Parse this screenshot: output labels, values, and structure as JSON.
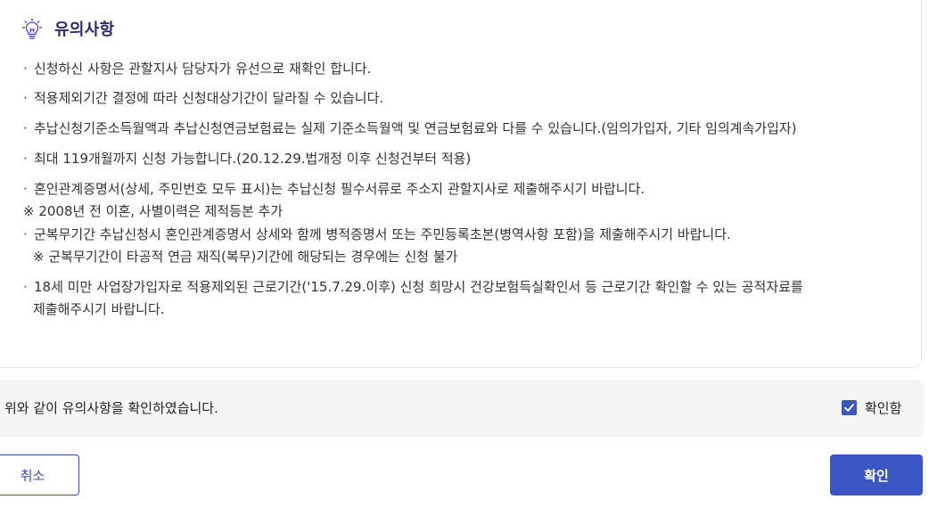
{
  "notice": {
    "title": "유의사항",
    "icon": "lightbulb-icon",
    "items": [
      "신청하신 사항은 관할지사 담당자가 유선으로 재확인 합니다.",
      "적용제외기간 결정에 따라 신청대상기간이 달라질 수 있습니다.",
      "추납신청기준소득월액과 추납신청연금보험료는 실제 기준소득월액 및 연금보험료와 다를 수 있습니다.(임의가입자, 기타 임의계속가입자)",
      "최대 119개월까지 신청 가능합니다.(20.12.29.법개정 이후 신청건부터 적용)",
      "혼인관계증명서(상세, 주민번호 모두 표시)는 추납신청 필수서류로 주소지 관할지사로 제출해주시기 바랍니다.",
      "군복무기간 추납신청시 혼인관계증명서 상세와 함께 병적증명서 또는 주민등록초본(병역사항 포함)을 제출해주시기 바랍니다.",
      "18세 미만 사업장가입자로 적용제외된 근로기간('15.7.29.이후) 신청 희망시 건강보험득실확인서 등 근로기간 확인할 수 있는 공적자료를",
      "제출해주시기 바랍니다."
    ],
    "note_divorce": "※ 2008년 전 이혼, 사별이력은 제적등본 추가",
    "note_military": "※ 군복무기간이 타공적 연금 재직(복무)기간에 해당되는 경우에는 신청 불가",
    "bullet": "·"
  },
  "confirm": {
    "text": "위와 같이 유의사항을 확인하였습니다.",
    "checkbox_label": "확인함",
    "checked": true
  },
  "buttons": {
    "cancel": "취소",
    "confirm": "확인"
  },
  "colors": {
    "title": "#2a2d6b",
    "accent": "#3a55c4",
    "confirm_bar_bg": "#f5f5f7",
    "icon": "#6b4fc1"
  }
}
